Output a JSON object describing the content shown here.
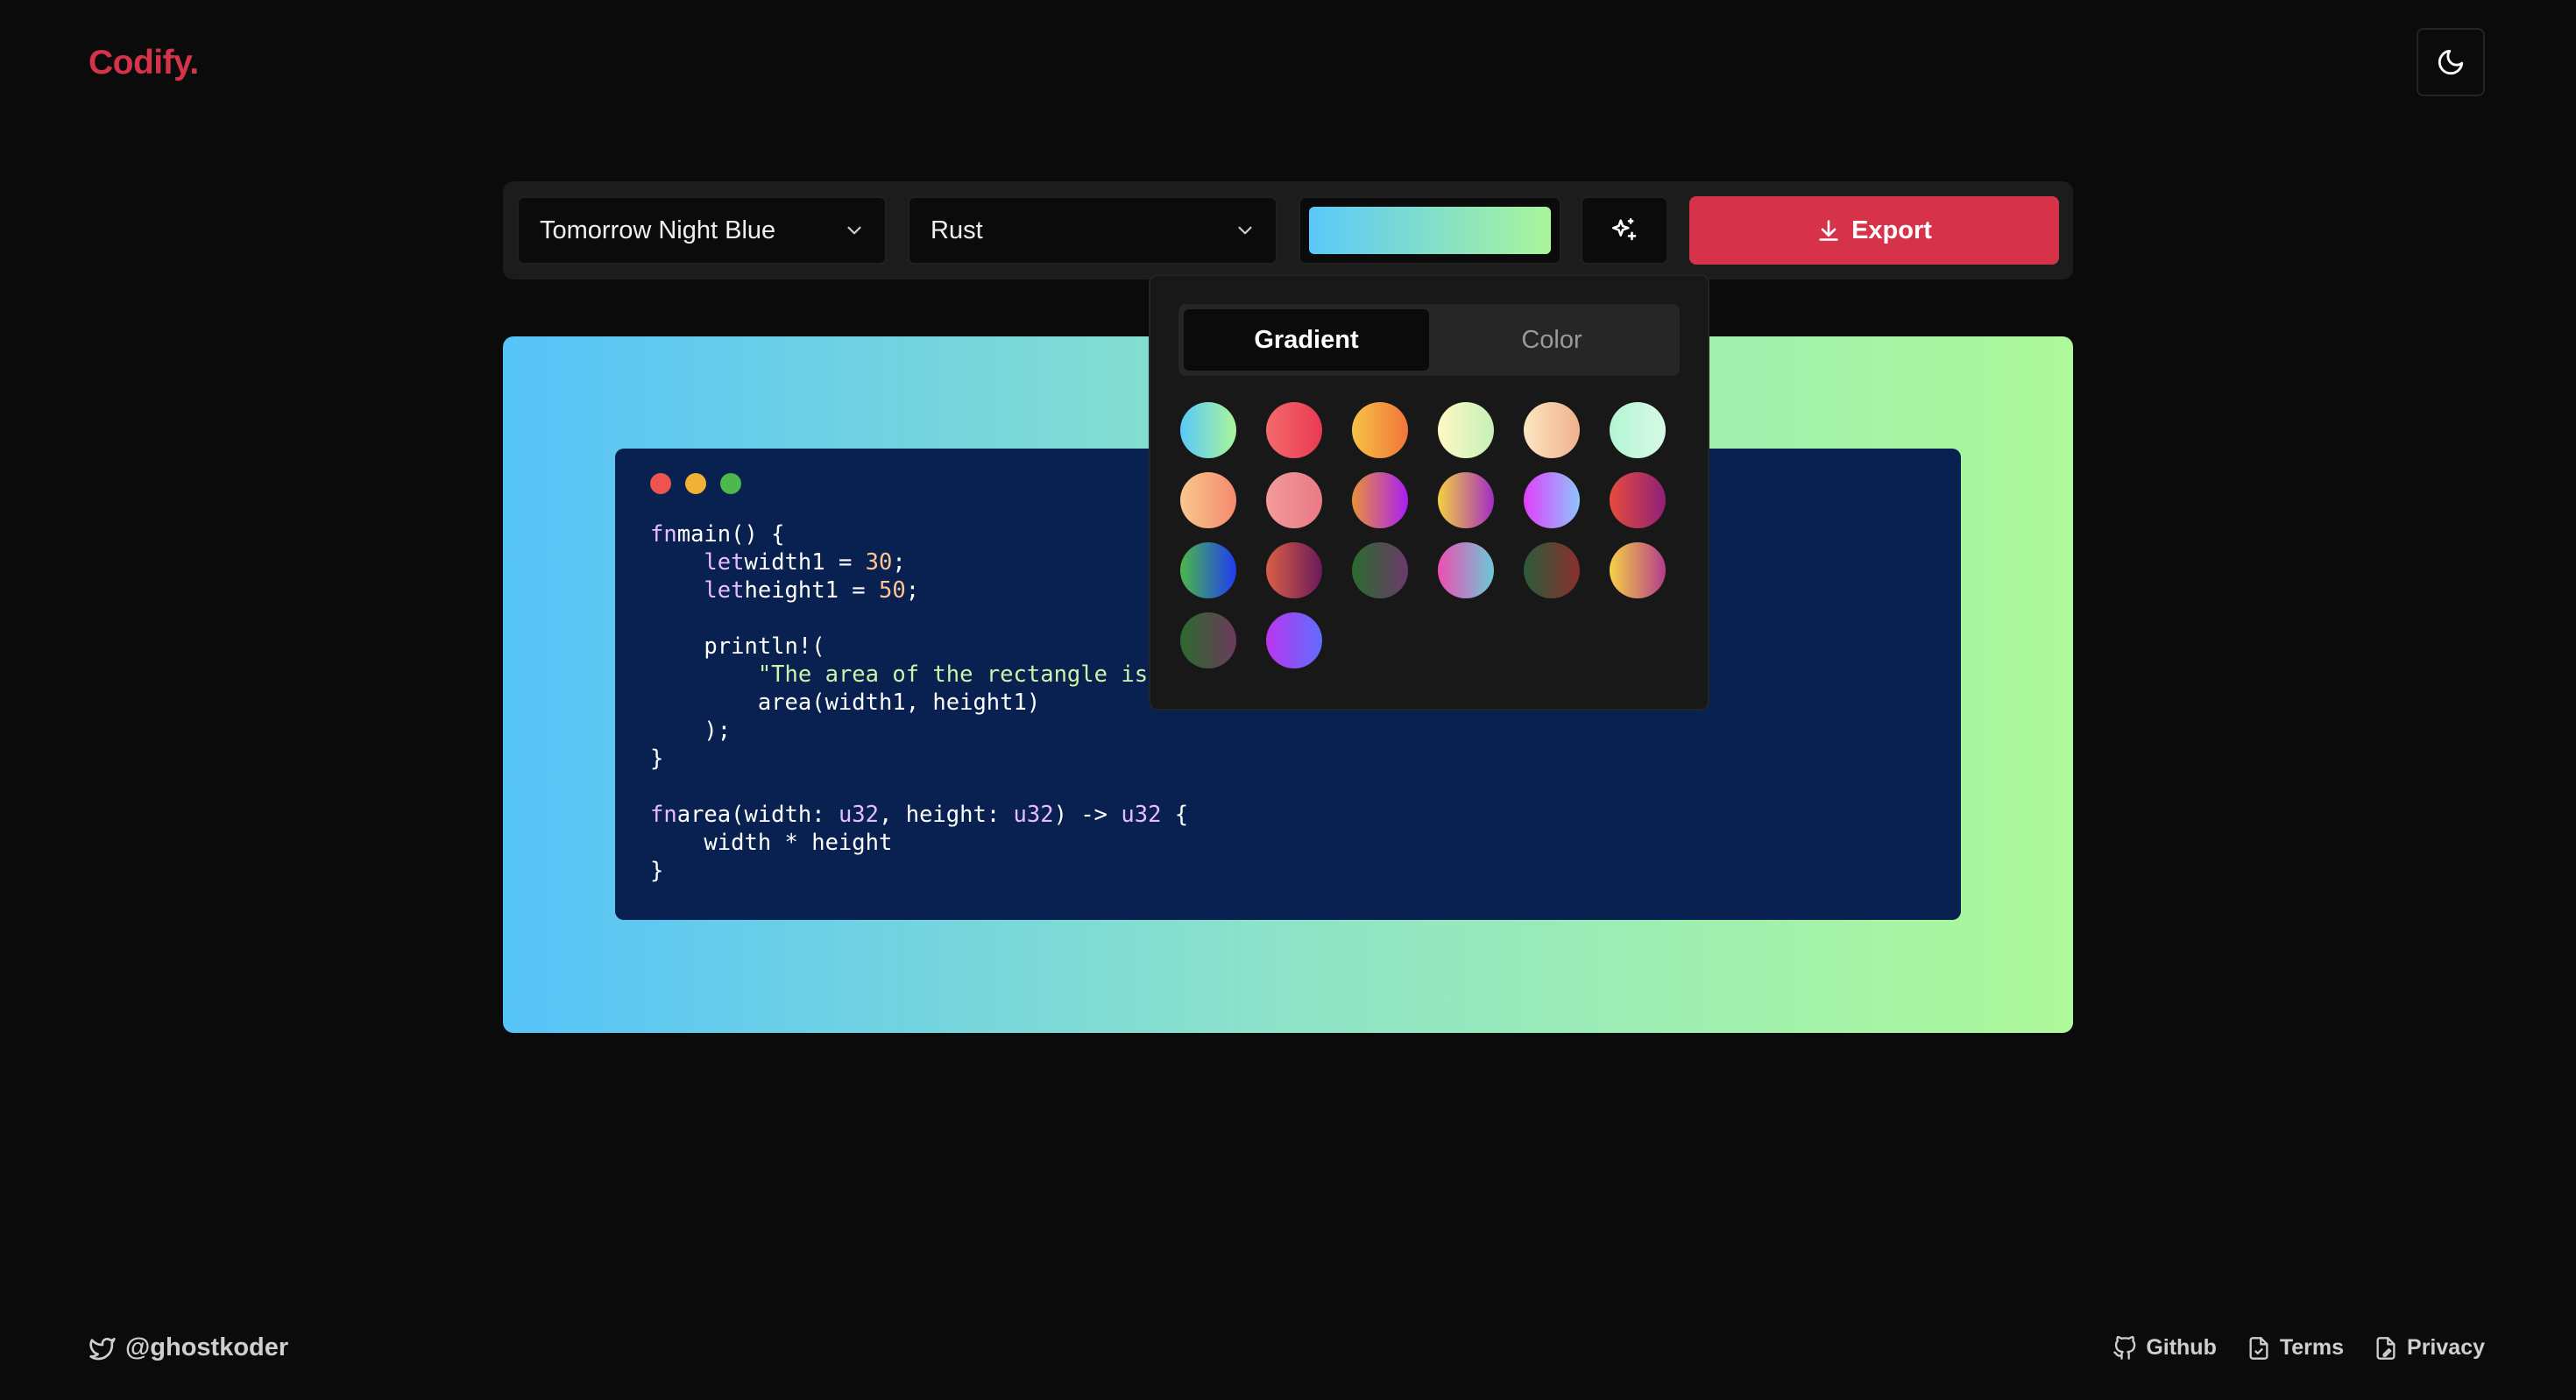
{
  "brand": {
    "logo": "Codify."
  },
  "toolbar": {
    "theme_select": "Tomorrow Night Blue",
    "language_select": "Rust",
    "background_gradient": [
      "#5ac8fa",
      "#aaf59a"
    ],
    "export_label": "Export"
  },
  "popover": {
    "tabs": [
      "Gradient",
      "Color"
    ],
    "active_tab": "Gradient",
    "gradients": [
      [
        "#5ac8fa",
        "#aaf59a"
      ],
      [
        "#f46a6a",
        "#e83a54"
      ],
      [
        "#f7c245",
        "#f0753a"
      ],
      [
        "#fff9c4",
        "#c6f0b8"
      ],
      [
        "#fde6c2",
        "#f0b08c"
      ],
      [
        "#b3f5d4",
        "#d6f9e6"
      ],
      [
        "#f9c78e",
        "#f58a6e"
      ],
      [
        "#f39a9a",
        "#e87a86"
      ],
      [
        "#e8913a",
        "#a91ef4"
      ],
      [
        "#f4d03f",
        "#a32cc4"
      ],
      [
        "#e040fb",
        "#8ec5fc"
      ],
      [
        "#e74c3c",
        "#8e2079"
      ],
      [
        "#4cb848",
        "#1f3bf5"
      ],
      [
        "#d95f45",
        "#6a1a5b"
      ],
      [
        "#2a6b2e",
        "#6b3a6b"
      ],
      [
        "#ef4eb2",
        "#6bc9d6"
      ],
      [
        "#2b5c3a",
        "#8a2e2e"
      ],
      [
        "#f7d046",
        "#b23c8c"
      ],
      [
        "#2d6a2f",
        "#6b3a5b"
      ],
      [
        "#b936ee",
        "#5f6dff"
      ]
    ]
  },
  "code_window": {
    "dots": [
      "#ef5350",
      "#f2b134",
      "#4cb84e"
    ],
    "lines": [
      [
        [
          "kw",
          "fn"
        ],
        [
          "",
          "main() {"
        ]
      ],
      [
        [
          "",
          "    "
        ],
        [
          "kw",
          "let"
        ],
        [
          "",
          "width1 = "
        ],
        [
          "num",
          "30"
        ],
        [
          "",
          ";"
        ]
      ],
      [
        [
          "",
          "    "
        ],
        [
          "kw",
          "let"
        ],
        [
          "",
          "height1 = "
        ],
        [
          "num",
          "50"
        ],
        [
          "",
          ";"
        ]
      ],
      [
        [
          "",
          ""
        ]
      ],
      [
        [
          "",
          "    println!("
        ]
      ],
      [
        [
          "",
          "        "
        ],
        [
          "str",
          "\"The area of the rectangle is {} square pixels.\""
        ],
        [
          "",
          ","
        ]
      ],
      [
        [
          "",
          "        area(width1, height1)"
        ]
      ],
      [
        [
          "",
          "    );"
        ]
      ],
      [
        [
          "",
          "}"
        ]
      ],
      [
        [
          "",
          ""
        ]
      ],
      [
        [
          "kw",
          "fn"
        ],
        [
          "",
          "area(width: "
        ],
        [
          "ty",
          "u32"
        ],
        [
          "",
          ", height: "
        ],
        [
          "ty",
          "u32"
        ],
        [
          "",
          ") -> "
        ],
        [
          "ty",
          "u32"
        ],
        [
          "",
          " {"
        ]
      ],
      [
        [
          "",
          "    width * height"
        ]
      ],
      [
        [
          "",
          "}"
        ]
      ]
    ]
  },
  "footer": {
    "handle": "@ghostkoder",
    "links": [
      "Github",
      "Terms",
      "Privacy"
    ]
  }
}
